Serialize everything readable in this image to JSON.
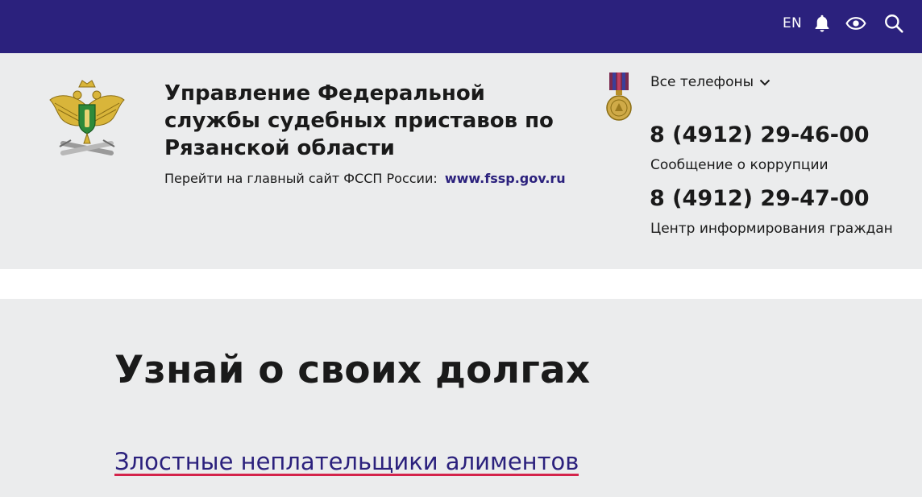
{
  "topbar": {
    "lang_label": "EN",
    "icons": [
      "bell-icon",
      "eye-icon",
      "search-icon"
    ],
    "background_color": "#2b217d"
  },
  "header": {
    "org_title_line1": "Управление Федеральной",
    "org_title_line2": "службы судебных приставов по",
    "org_title_line3": "Рязанской области",
    "site_link_prefix": "Перейти на главный сайт ФССП России:",
    "site_link_text": "www.fssp.gov.ru",
    "phones_toggle_label": "Все телефоны",
    "phone_1": "8 (4912) 29-46-00",
    "phone_1_caption": "Сообщение о коррупции",
    "phone_2": "8 (4912) 29-47-00",
    "phone_2_caption": "Центр информирования граждан",
    "background_color": "#ebeced"
  },
  "main": {
    "heading": "Узнай о своих долгах",
    "debtors_link": "Злостные неплательщики алиментов",
    "link_underline_color": "#d4244b"
  }
}
